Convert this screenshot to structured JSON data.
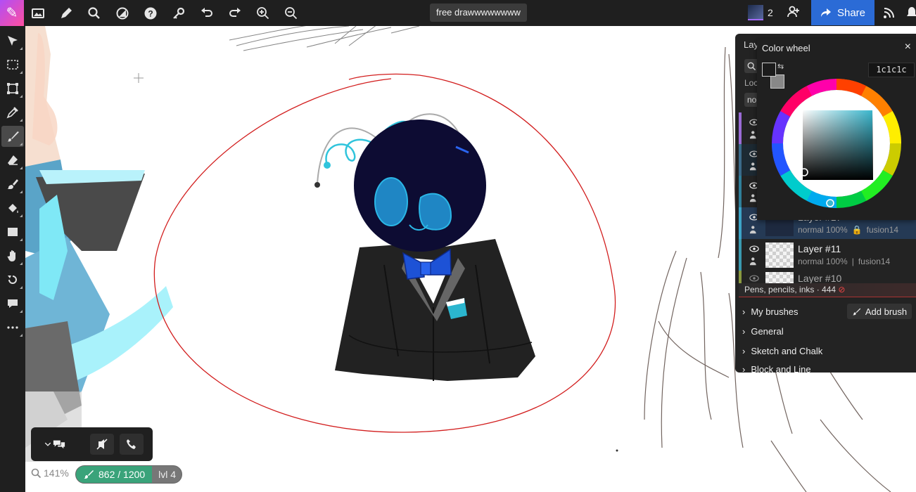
{
  "app": {
    "document_title": "free drawwwwwwww",
    "collaborator_count": "2",
    "share_label": "Share"
  },
  "topbar_icons": [
    "image-icon",
    "pencil-icon",
    "search-icon",
    "adjust-icon",
    "help-icon",
    "key-icon",
    "undo-icon",
    "redo-icon",
    "zoom-in-icon",
    "zoom-out-icon"
  ],
  "left_tools": [
    "move-select-icon",
    "rect-select-icon",
    "transform-icon",
    "eyedropper-icon",
    "brush-icon",
    "eraser-icon",
    "smudge-icon",
    "fill-icon",
    "rectangle-icon",
    "hand-icon",
    "rotate-icon",
    "comment-icon",
    "more-icon"
  ],
  "status": {
    "zoom": "141%",
    "xp_text": "862 / 1200",
    "xp_fraction": 0.718,
    "level": "lvl 4"
  },
  "layers_panel": {
    "title": "Lay",
    "lock_label": "Loc",
    "blend_stub": "no",
    "layers": [
      {
        "name": "",
        "blend": "",
        "owner": "",
        "accent": "#9b6bd6"
      },
      {
        "name": "",
        "blend": "",
        "owner": "",
        "accent": "#3b6b8a"
      },
      {
        "name": "",
        "blend": "",
        "owner": "",
        "accent": "#2f7f9a"
      },
      {
        "name": "Layer #17",
        "blend": "normal 100%",
        "owner": "fusion14",
        "accent": "#3da5c8",
        "selected": true
      },
      {
        "name": "Layer #11",
        "blend": "normal 100%",
        "owner": "fusion14",
        "accent": "#3a9ab0"
      },
      {
        "name": "Layer #10",
        "blend": "",
        "owner": "",
        "accent": "#8a9a40"
      }
    ]
  },
  "brushes": {
    "banner": "Pens, pencils, inks · 444",
    "add_brush_label": "Add brush",
    "groups": [
      "My brushes",
      "General",
      "Sketch and Chalk",
      "Block and Line"
    ]
  },
  "color_wheel": {
    "title": "Color wheel",
    "hex_value": "1c1c1c",
    "foreground": "#1c1c1c",
    "background": "#888888",
    "hue": "#3ab8cf"
  },
  "colors": {
    "toolbar_bg": "#1f1f1f",
    "share_blue": "#2b6bd6",
    "xp_green": "#3aa37a"
  }
}
